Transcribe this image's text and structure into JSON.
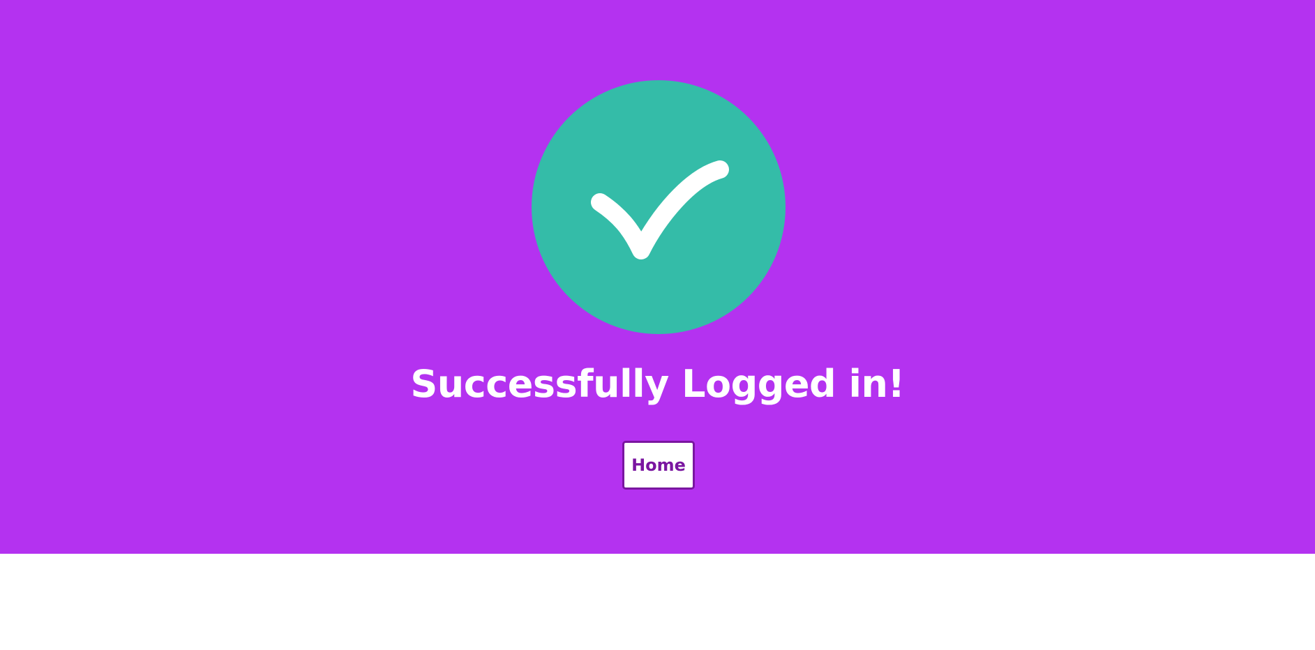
{
  "colors": {
    "background_accent": "#b432f0",
    "check_circle": "#34bca8",
    "button_text": "#7a16a0",
    "text_light": "#ffffff"
  },
  "status": {
    "icon": "checkmark-icon",
    "heading": "Successfully Logged in!"
  },
  "actions": {
    "home_label": "Home"
  }
}
